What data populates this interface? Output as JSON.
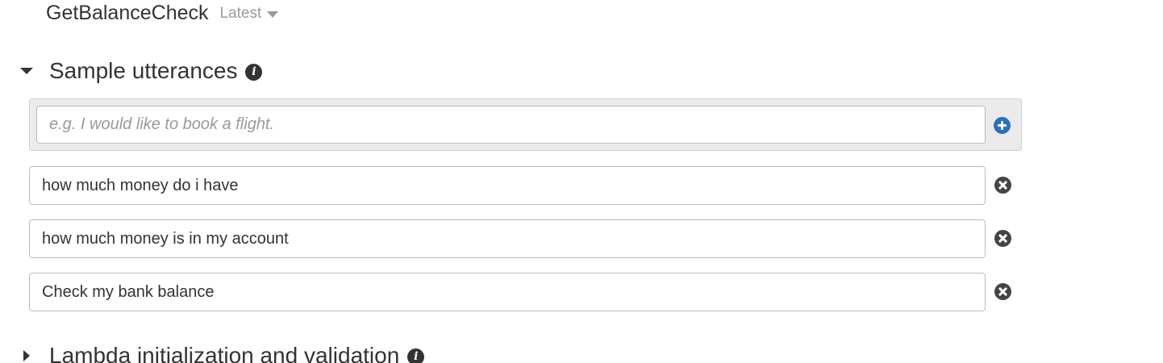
{
  "intent": {
    "name": "GetBalanceCheck",
    "version": "Latest"
  },
  "sample_utterances": {
    "title": "Sample utterances",
    "new_placeholder": "e.g. I would like to book a flight.",
    "items": [
      "how much money do i have",
      "how much money is in my account",
      "Check my bank balance"
    ]
  },
  "lambda_section": {
    "title": "Lambda initialization and validation"
  },
  "icons": {
    "info": "info-icon",
    "add": "plus-circle-icon",
    "remove": "x-circle-icon",
    "add_color": "#2b6fbf"
  }
}
